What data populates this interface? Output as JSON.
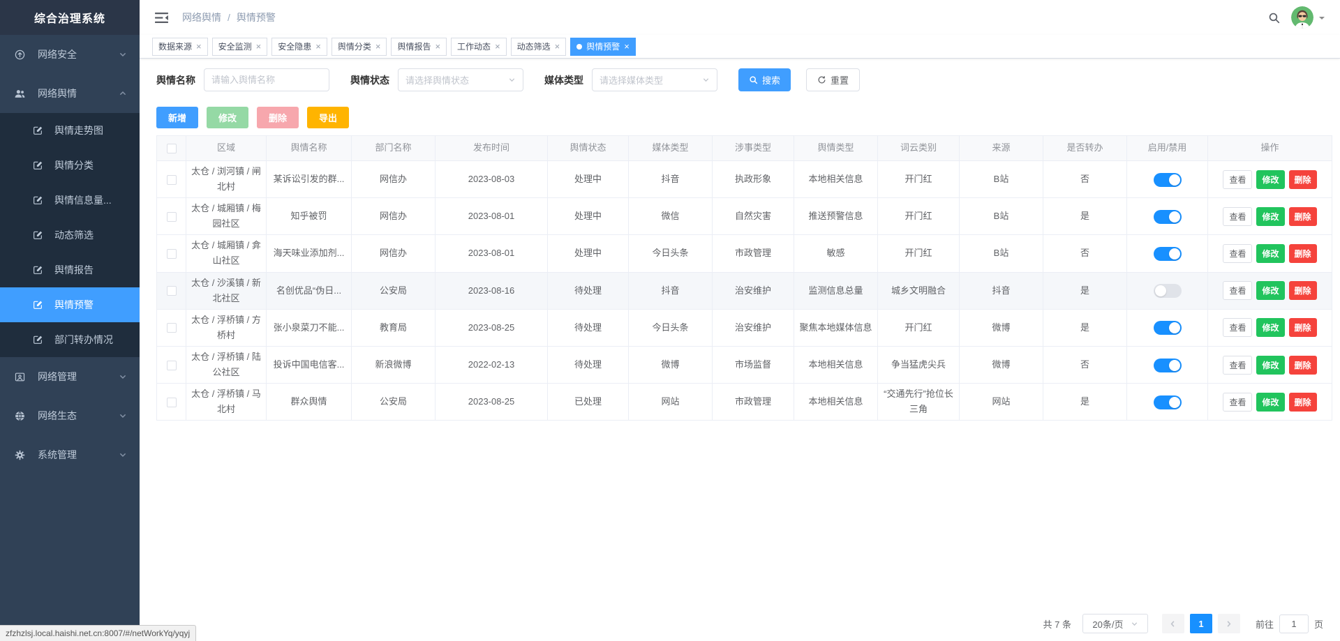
{
  "app": {
    "title": "综合治理系统"
  },
  "topbar": {
    "breadcrumb": {
      "parent": "网络舆情",
      "separator": "/",
      "current": "舆情预警"
    }
  },
  "sidebar": {
    "items": [
      {
        "label": "网络安全",
        "icon": "cloud-upload-icon",
        "expanded": false
      },
      {
        "label": "网络舆情",
        "icon": "users-icon",
        "expanded": true,
        "active_index": 5,
        "children": [
          "舆情走势图",
          "舆情分类",
          "舆情信息量...",
          "动态筛选",
          "舆情报告",
          "舆情预警",
          "部门转办情况"
        ]
      },
      {
        "label": "网络管理",
        "icon": "monitor-icon",
        "expanded": false
      },
      {
        "label": "网络生态",
        "icon": "globe-icon",
        "expanded": false
      },
      {
        "label": "系统管理",
        "icon": "gear-icon",
        "expanded": false
      }
    ]
  },
  "tabs": [
    {
      "label": "数据来源",
      "active": false
    },
    {
      "label": "安全监测",
      "active": false
    },
    {
      "label": "安全隐患",
      "active": false
    },
    {
      "label": "舆情分类",
      "active": false
    },
    {
      "label": "舆情报告",
      "active": false
    },
    {
      "label": "工作动态",
      "active": false
    },
    {
      "label": "动态筛选",
      "active": false
    },
    {
      "label": "舆情预警",
      "active": true
    }
  ],
  "filters": {
    "name_label": "舆情名称",
    "name_placeholder": "请输入舆情名称",
    "status_label": "舆情状态",
    "status_placeholder": "请选择舆情状态",
    "media_label": "媒体类型",
    "media_placeholder": "请选择媒体类型",
    "search_label": "搜索",
    "reset_label": "重置"
  },
  "toolbar": {
    "add": "新增",
    "edit": "修改",
    "delete": "删除",
    "export": "导出"
  },
  "table": {
    "columns": [
      "区域",
      "舆情名称",
      "部门名称",
      "发布时间",
      "舆情状态",
      "媒体类型",
      "涉事类型",
      "舆情类型",
      "词云类别",
      "来源",
      "是否转办",
      "启用/禁用",
      "操作"
    ],
    "row_actions": [
      "查看",
      "修改",
      "删除"
    ],
    "rows": [
      {
        "region": "太仓 / 浏河镇 / 闸北村",
        "name": "某诉讼引发的群...",
        "dept": "网信办",
        "date": "2023-08-03",
        "status": "处理中",
        "media": "抖音",
        "involve": "执政形象",
        "type": "本地相关信息",
        "cloud": "开门红",
        "source": "B站",
        "transfer": "否",
        "enabled": true,
        "highlight": false
      },
      {
        "region": "太仓 / 城厢镇 / 梅园社区",
        "name": "知乎被罚",
        "dept": "网信办",
        "date": "2023-08-01",
        "status": "处理中",
        "media": "微信",
        "involve": "自然灾害",
        "type": "推送预警信息",
        "cloud": "开门红",
        "source": "B站",
        "transfer": "是",
        "enabled": true,
        "highlight": false
      },
      {
        "region": "太仓 / 城厢镇 / 弇山社区",
        "name": "海天味业添加剂...",
        "dept": "网信办",
        "date": "2023-08-01",
        "status": "处理中",
        "media": "今日头条",
        "involve": "市政管理",
        "type": "敏感",
        "cloud": "开门红",
        "source": "B站",
        "transfer": "否",
        "enabled": true,
        "highlight": false
      },
      {
        "region": "太仓 / 沙溪镇 / 新北社区",
        "name": "名创优品“伪日...",
        "dept": "公安局",
        "date": "2023-08-16",
        "status": "待处理",
        "media": "抖音",
        "involve": "治安维护",
        "type": "监测信息总量",
        "cloud": "城乡文明融合",
        "source": "抖音",
        "transfer": "是",
        "enabled": false,
        "highlight": true
      },
      {
        "region": "太仓 / 浮桥镇 / 方桥村",
        "name": "张小泉菜刀不能...",
        "dept": "教育局",
        "date": "2023-08-25",
        "status": "待处理",
        "media": "今日头条",
        "involve": "治安维护",
        "type": "聚焦本地媒体信息",
        "cloud": "开门红",
        "source": "微博",
        "transfer": "是",
        "enabled": true,
        "highlight": false
      },
      {
        "region": "太仓 / 浮桥镇 / 陆公社区",
        "name": "投诉中国电信客...",
        "dept": "新浪微博",
        "date": "2022-02-13",
        "status": "待处理",
        "media": "微博",
        "involve": "市场监督",
        "type": "本地相关信息",
        "cloud": "争当猛虎尖兵",
        "source": "微博",
        "transfer": "否",
        "enabled": true,
        "highlight": false
      },
      {
        "region": "太仓 / 浮桥镇 / 马北村",
        "name": "群众舆情",
        "dept": "公安局",
        "date": "2023-08-25",
        "status": "已处理",
        "media": "网站",
        "involve": "市政管理",
        "type": "本地相关信息",
        "cloud": "“交通先行”抢位长三角",
        "source": "网站",
        "transfer": "是",
        "enabled": true,
        "highlight": false
      }
    ]
  },
  "pagination": {
    "total": "共 7 条",
    "page_size": "20条/页",
    "current_page": "1",
    "goto_prefix": "前往",
    "goto_value": "1",
    "goto_suffix": "页"
  },
  "statusbar": {
    "url": "zfzhzlsj.local.haishi.net.cn:8007/#/netWorkYq/yqyj"
  },
  "colors": {
    "primary_blue": "#409eff",
    "toggle_on_blue": "#1890ff",
    "sidebar_bg": "#304156",
    "submenu_bg": "#1f2d3d",
    "active_item_bg": "#409eff",
    "edit_green": "#21c45d",
    "delete_red": "#f5433c",
    "export_yellow": "#ffb400",
    "edit_disabled_green": "#95d9a5",
    "delete_disabled_pink": "#f7a7ad"
  }
}
